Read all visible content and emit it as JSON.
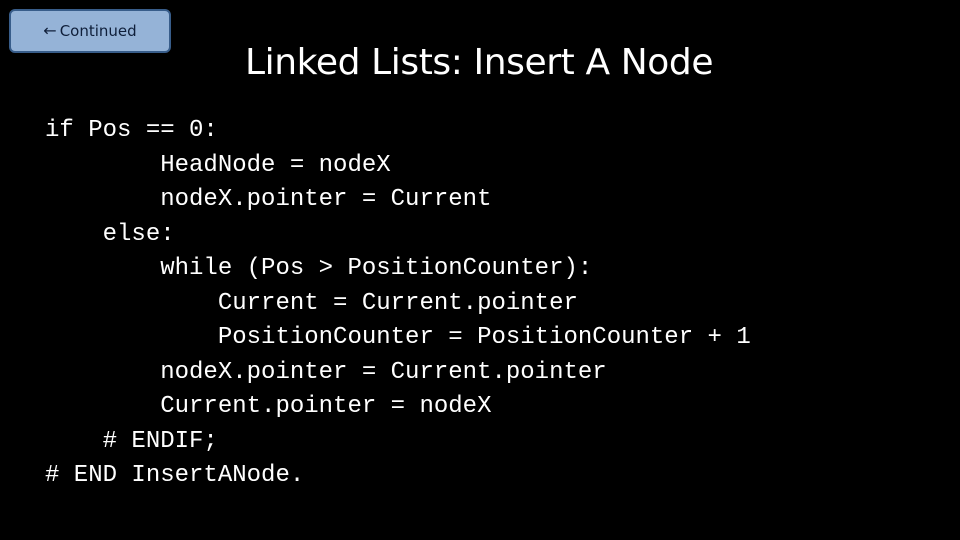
{
  "back_button": {
    "icon": "arrow-left-icon",
    "glyph": "←",
    "label": "Continued"
  },
  "title": "Linked Lists: Insert A Node",
  "colors": {
    "background": "#000000",
    "text": "#ffffff",
    "button_fill": "#95b3d7",
    "button_border": "#385d8a"
  },
  "code_lines": [
    "if Pos == 0:",
    "        HeadNode = nodeX",
    "        nodeX.pointer = Current",
    "    else:",
    "        while (Pos > PositionCounter):",
    "            Current = Current.pointer",
    "            PositionCounter = PositionCounter + 1",
    "        nodeX.pointer = Current.pointer",
    "        Current.pointer = nodeX",
    "    # ENDIF;",
    "# END InsertANode."
  ]
}
